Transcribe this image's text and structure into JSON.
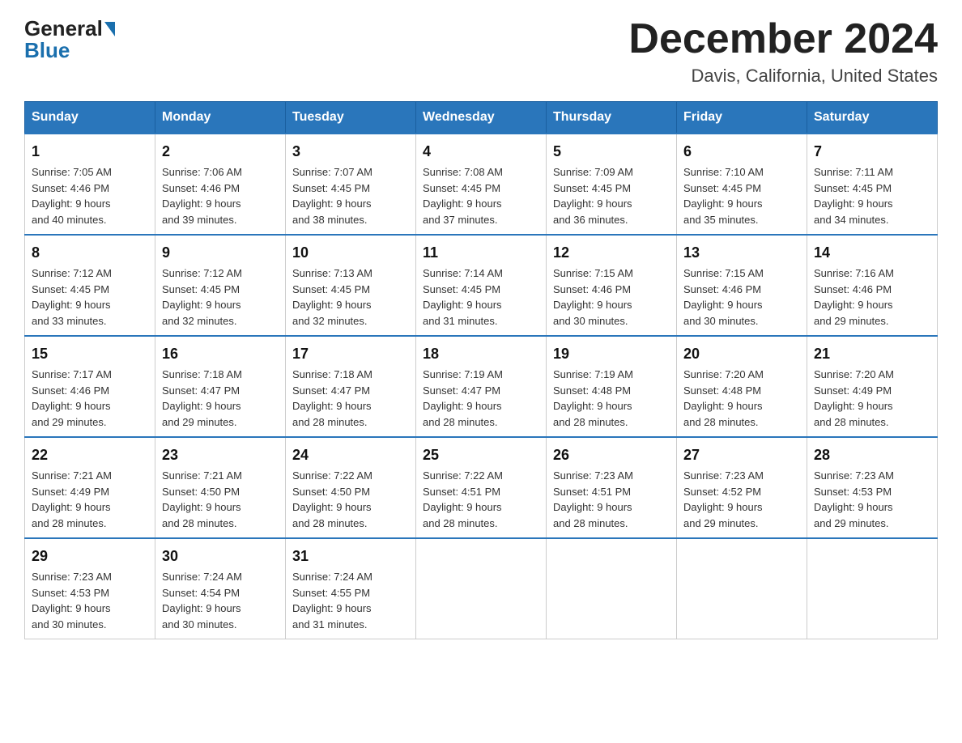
{
  "header": {
    "logo_general": "General",
    "logo_blue": "Blue",
    "month_title": "December 2024",
    "location": "Davis, California, United States"
  },
  "weekdays": [
    "Sunday",
    "Monday",
    "Tuesday",
    "Wednesday",
    "Thursday",
    "Friday",
    "Saturday"
  ],
  "weeks": [
    [
      {
        "day": "1",
        "sunrise": "7:05 AM",
        "sunset": "4:46 PM",
        "daylight": "9 hours and 40 minutes."
      },
      {
        "day": "2",
        "sunrise": "7:06 AM",
        "sunset": "4:46 PM",
        "daylight": "9 hours and 39 minutes."
      },
      {
        "day": "3",
        "sunrise": "7:07 AM",
        "sunset": "4:45 PM",
        "daylight": "9 hours and 38 minutes."
      },
      {
        "day": "4",
        "sunrise": "7:08 AM",
        "sunset": "4:45 PM",
        "daylight": "9 hours and 37 minutes."
      },
      {
        "day": "5",
        "sunrise": "7:09 AM",
        "sunset": "4:45 PM",
        "daylight": "9 hours and 36 minutes."
      },
      {
        "day": "6",
        "sunrise": "7:10 AM",
        "sunset": "4:45 PM",
        "daylight": "9 hours and 35 minutes."
      },
      {
        "day": "7",
        "sunrise": "7:11 AM",
        "sunset": "4:45 PM",
        "daylight": "9 hours and 34 minutes."
      }
    ],
    [
      {
        "day": "8",
        "sunrise": "7:12 AM",
        "sunset": "4:45 PM",
        "daylight": "9 hours and 33 minutes."
      },
      {
        "day": "9",
        "sunrise": "7:12 AM",
        "sunset": "4:45 PM",
        "daylight": "9 hours and 32 minutes."
      },
      {
        "day": "10",
        "sunrise": "7:13 AM",
        "sunset": "4:45 PM",
        "daylight": "9 hours and 32 minutes."
      },
      {
        "day": "11",
        "sunrise": "7:14 AM",
        "sunset": "4:45 PM",
        "daylight": "9 hours and 31 minutes."
      },
      {
        "day": "12",
        "sunrise": "7:15 AM",
        "sunset": "4:46 PM",
        "daylight": "9 hours and 30 minutes."
      },
      {
        "day": "13",
        "sunrise": "7:15 AM",
        "sunset": "4:46 PM",
        "daylight": "9 hours and 30 minutes."
      },
      {
        "day": "14",
        "sunrise": "7:16 AM",
        "sunset": "4:46 PM",
        "daylight": "9 hours and 29 minutes."
      }
    ],
    [
      {
        "day": "15",
        "sunrise": "7:17 AM",
        "sunset": "4:46 PM",
        "daylight": "9 hours and 29 minutes."
      },
      {
        "day": "16",
        "sunrise": "7:18 AM",
        "sunset": "4:47 PM",
        "daylight": "9 hours and 29 minutes."
      },
      {
        "day": "17",
        "sunrise": "7:18 AM",
        "sunset": "4:47 PM",
        "daylight": "9 hours and 28 minutes."
      },
      {
        "day": "18",
        "sunrise": "7:19 AM",
        "sunset": "4:47 PM",
        "daylight": "9 hours and 28 minutes."
      },
      {
        "day": "19",
        "sunrise": "7:19 AM",
        "sunset": "4:48 PM",
        "daylight": "9 hours and 28 minutes."
      },
      {
        "day": "20",
        "sunrise": "7:20 AM",
        "sunset": "4:48 PM",
        "daylight": "9 hours and 28 minutes."
      },
      {
        "day": "21",
        "sunrise": "7:20 AM",
        "sunset": "4:49 PM",
        "daylight": "9 hours and 28 minutes."
      }
    ],
    [
      {
        "day": "22",
        "sunrise": "7:21 AM",
        "sunset": "4:49 PM",
        "daylight": "9 hours and 28 minutes."
      },
      {
        "day": "23",
        "sunrise": "7:21 AM",
        "sunset": "4:50 PM",
        "daylight": "9 hours and 28 minutes."
      },
      {
        "day": "24",
        "sunrise": "7:22 AM",
        "sunset": "4:50 PM",
        "daylight": "9 hours and 28 minutes."
      },
      {
        "day": "25",
        "sunrise": "7:22 AM",
        "sunset": "4:51 PM",
        "daylight": "9 hours and 28 minutes."
      },
      {
        "day": "26",
        "sunrise": "7:23 AM",
        "sunset": "4:51 PM",
        "daylight": "9 hours and 28 minutes."
      },
      {
        "day": "27",
        "sunrise": "7:23 AM",
        "sunset": "4:52 PM",
        "daylight": "9 hours and 29 minutes."
      },
      {
        "day": "28",
        "sunrise": "7:23 AM",
        "sunset": "4:53 PM",
        "daylight": "9 hours and 29 minutes."
      }
    ],
    [
      {
        "day": "29",
        "sunrise": "7:23 AM",
        "sunset": "4:53 PM",
        "daylight": "9 hours and 30 minutes."
      },
      {
        "day": "30",
        "sunrise": "7:24 AM",
        "sunset": "4:54 PM",
        "daylight": "9 hours and 30 minutes."
      },
      {
        "day": "31",
        "sunrise": "7:24 AM",
        "sunset": "4:55 PM",
        "daylight": "9 hours and 31 minutes."
      },
      null,
      null,
      null,
      null
    ]
  ],
  "labels": {
    "sunrise_prefix": "Sunrise: ",
    "sunset_prefix": "Sunset: ",
    "daylight_prefix": "Daylight: "
  }
}
